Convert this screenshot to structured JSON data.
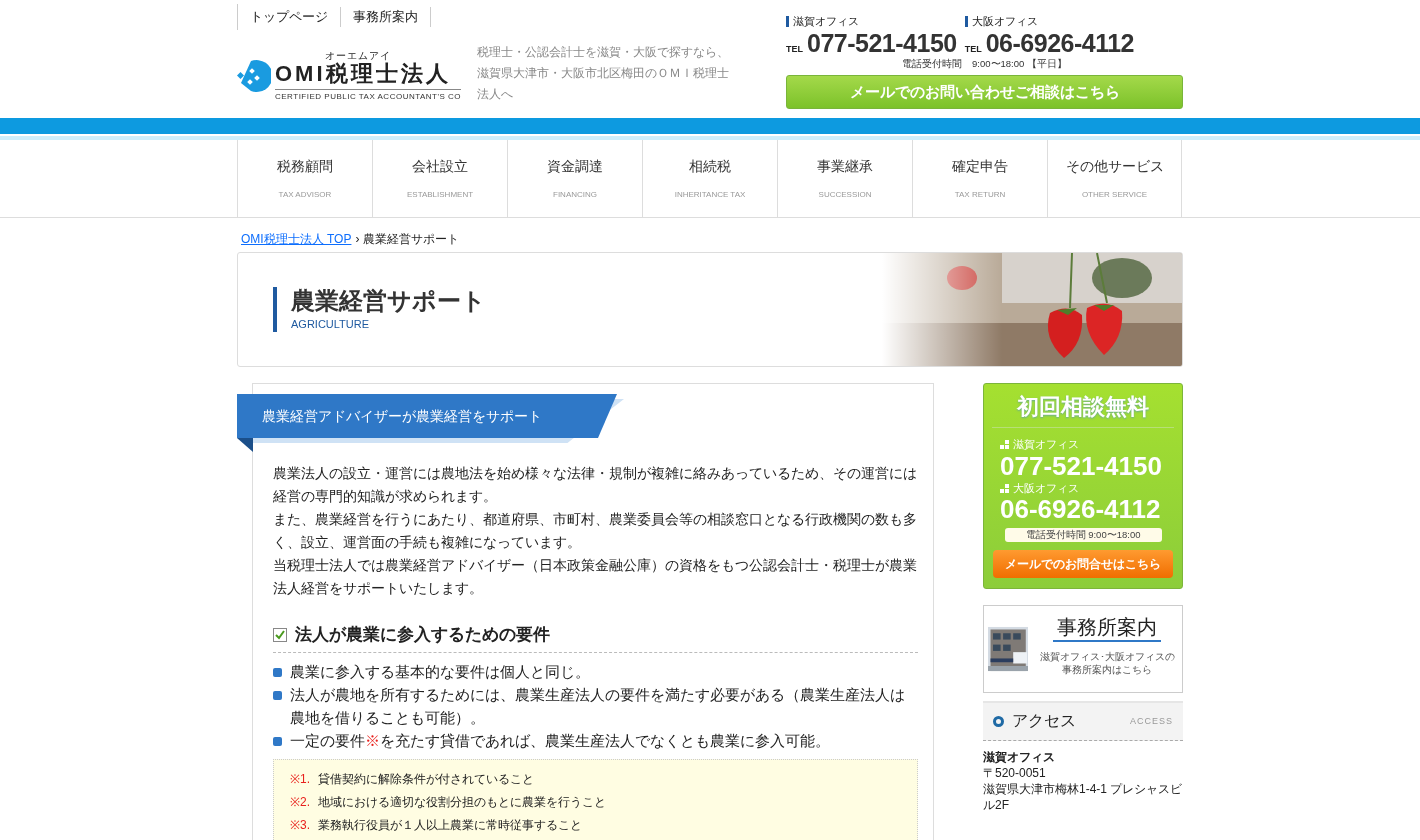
{
  "top_links": [
    {
      "label": "トップページ"
    },
    {
      "label": "事務所案内"
    }
  ],
  "logo": {
    "kana": "オーエムアイ",
    "name": "OMI税理士法人",
    "tagline": "CERTIFIED PUBLIC TAX ACCOUNTANT'S CO"
  },
  "intro": "税理士・公認会計士を滋賀・大阪で探すなら、滋賀県大津市・大阪市北区梅田のＯＭＩ税理士法人へ",
  "offices": [
    {
      "name": "滋賀オフィス",
      "tel_label": "TEL",
      "phone": "077-521-4150"
    },
    {
      "name": "大阪オフィス",
      "tel_label": "TEL",
      "phone": "06-6926-4112"
    }
  ],
  "hours": "電話受付時間　9:00〜18:00 【平日】",
  "mail_button": "メールでのお問い合わせご相談はこちら",
  "nav": [
    {
      "label": "税務顧問",
      "sub": "TAX ADVISOR"
    },
    {
      "label": "会社設立",
      "sub": "ESTABLISHMENT"
    },
    {
      "label": "資金調達",
      "sub": "FINANCING"
    },
    {
      "label": "相続税",
      "sub": "INHERITANCE TAX"
    },
    {
      "label": "事業継承",
      "sub": "SUCCESSION"
    },
    {
      "label": "確定申告",
      "sub": "TAX RETURN"
    },
    {
      "label": "その他サービス",
      "sub": "OTHER SERVICE"
    }
  ],
  "breadcrumb": {
    "link": "OMI税理士法人 TOP",
    "separator": "›",
    "current": "農業経営サポート"
  },
  "hero": {
    "title": "農業経営サポート",
    "subtitle": "AGRICULTURE",
    "kind": "picture"
  },
  "section_heading": "農業経営アドバイザーが農業経営をサポート",
  "paragraph_lines": [
    "農業法人の設立・運営には農地法を始め様々な法律・規制が複雑に絡みあっているため、その運営には経営の専門的知識が求められます。",
    "また、農業経営を行うにあたり、都道府県、市町村、農業委員会等の相談窓口となる行政機関の数も多く、設立、運営面の手続も複雑になっています。",
    "当税理士法人では農業経営アドバイザー（日本政策金融公庫）の資格をもつ公認会計士・税理士が農業法人経営をサポートいたします。"
  ],
  "subheading": {
    "text": "法人が農業に参入するための要件",
    "checked": true
  },
  "requirements": [
    {
      "parts": [
        {
          "kind": "plain",
          "text": "農業に参入する基本的な要件は個人と同じ。"
        }
      ]
    },
    {
      "parts": [
        {
          "kind": "plain",
          "text": "法人が農地を所有するためには、農業生産法人の要件を満たす必要がある（農業生産法人は農地を借りることも可能）。"
        }
      ]
    },
    {
      "parts": [
        {
          "kind": "plain",
          "text": "一定の要件"
        },
        {
          "kind": "note",
          "text": "※"
        },
        {
          "kind": "plain",
          "text": "を充たす貸借であれば、農業生産法人でなくとも農業に参入可能。"
        }
      ]
    }
  ],
  "notes": [
    {
      "mark": "※1.",
      "text": "貸借契約に解除条件が付されていること"
    },
    {
      "mark": "※2.",
      "text": "地域における適切な役割分担のもとに農業を行うこと"
    },
    {
      "mark": "※3.",
      "text": "業務執行役員が１人以上農業に常時従事すること"
    }
  ],
  "sidebar": {
    "consult": {
      "title": "初回相談無料",
      "offices": [
        {
          "name": "滋賀オフィス",
          "phone": "077-521-4150"
        },
        {
          "name": "大阪オフィス",
          "phone": "06-6926-4112"
        }
      ],
      "hours": "電話受付時間 9:00〜18:00",
      "button": "メールでのお問合せはこちら"
    },
    "office_guide": {
      "title": "事務所案内",
      "caption": "滋賀オフィス･大阪オフィスの事務所案内はこちら"
    },
    "access": {
      "title": "アクセス",
      "sub": "ACCESS",
      "office": "滋賀オフィス",
      "postal": "〒520-0051",
      "address": "滋賀県大津市梅林1-4-1 プレシャスビル2F"
    }
  }
}
